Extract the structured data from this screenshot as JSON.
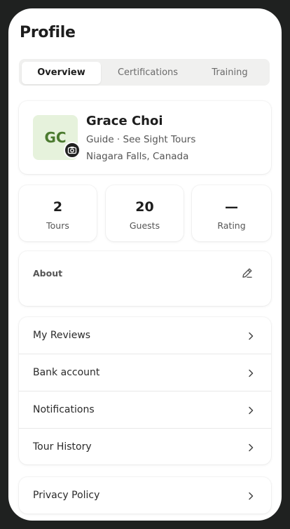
{
  "header": {
    "title": "Profile"
  },
  "tabs": [
    {
      "label": "Overview",
      "active": true
    },
    {
      "label": "Certifications",
      "active": false
    },
    {
      "label": "Training",
      "active": false
    }
  ],
  "profile": {
    "initials": "GC",
    "name": "Grace Choi",
    "role": "Guide · See Sight Tours",
    "location": "Niagara Falls, Canada",
    "avatar_bg": "#e6f2dc",
    "avatar_fg": "#4b7a2f"
  },
  "stats": [
    {
      "value": "2",
      "label": "Tours"
    },
    {
      "value": "20",
      "label": "Guests"
    },
    {
      "value": "—",
      "label": "Rating"
    }
  ],
  "about": {
    "label": "About",
    "edit_icon": "pencil-icon"
  },
  "menu": [
    {
      "label": "My Reviews"
    },
    {
      "label": "Bank account"
    },
    {
      "label": "Notifications"
    },
    {
      "label": "Tour History"
    }
  ],
  "legal": {
    "label": "Privacy Policy"
  },
  "icons": {
    "chevron": "chevron-right-icon",
    "camera": "camera-icon"
  }
}
